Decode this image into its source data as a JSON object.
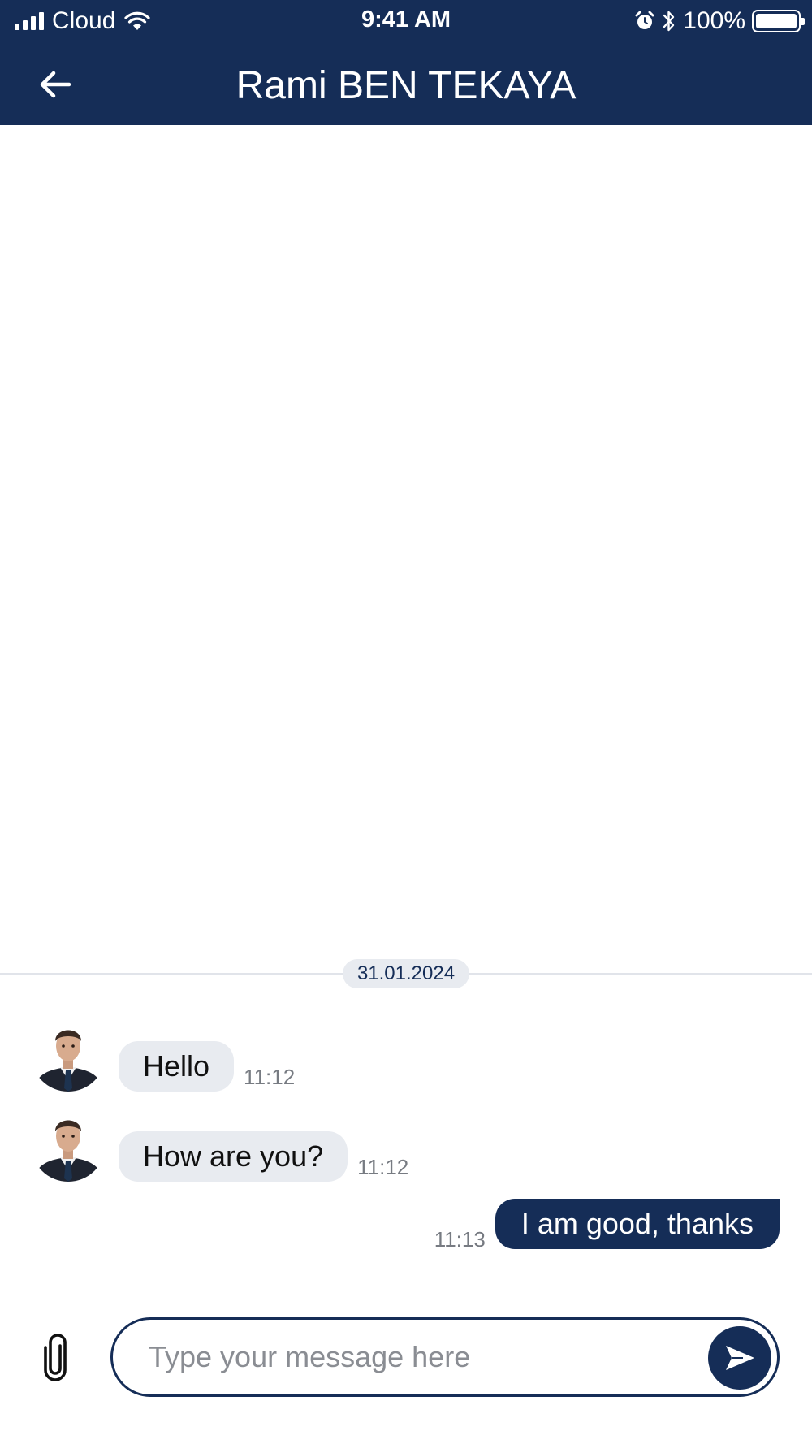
{
  "status_bar": {
    "carrier": "Cloud",
    "time": "9:41 AM",
    "battery_percent": "100%"
  },
  "app_bar": {
    "title": "Rami BEN TEKAYA",
    "back_icon": "arrow-left-icon"
  },
  "conversation": {
    "date": "31.01.2024",
    "messages": [
      {
        "direction": "incoming",
        "text": "Hello",
        "time": "11:12"
      },
      {
        "direction": "incoming",
        "text": "How are you?",
        "time": "11:12"
      },
      {
        "direction": "outgoing",
        "text": "I am good, thanks",
        "time": "11:13"
      }
    ]
  },
  "composer": {
    "placeholder": "Type your message here",
    "value": "",
    "attach_icon": "paperclip-icon",
    "send_icon": "send-icon"
  },
  "colors": {
    "primary": "#152d57",
    "incoming_bubble": "#e8ebf0",
    "divider": "#e1e4ea"
  }
}
